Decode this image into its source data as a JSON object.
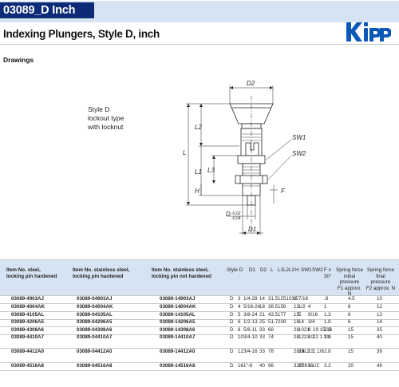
{
  "header": {
    "title": "03089_D Inch",
    "logo_text": "kipp"
  },
  "subtitle": "Indexing Plungers, Style D, inch",
  "section_label": "Drawings",
  "drawing": {
    "note_lines": [
      "Style D",
      "lockout type",
      "with locknut"
    ],
    "labels": {
      "D2": "D2",
      "SW1": "SW1",
      "SW2": "SW2",
      "L": "L",
      "L2": "L2",
      "L1": "L1",
      "L3": "L3",
      "H": "H",
      "F": "F",
      "D1": "D1",
      "D": "D",
      "tol_top": "-0,02",
      "tol_bottom": "-0,04"
    }
  },
  "table": {
    "headers": {
      "item_steel": [
        "Item No. steel,",
        "locking pin hardened"
      ],
      "item_stainless_hard": [
        "Item No. stainless steel,",
        "locking pin hardened"
      ],
      "item_stainless_not": [
        "Item No. stainless steel,",
        "locking pin not hardened"
      ],
      "style": "Style D",
      "d1": "D1",
      "d2": "D2",
      "l": "L",
      "l1": "L1L2L3",
      "h": "H",
      "sw1": "SW1",
      "sw2": "SW2",
      "f": [
        "F x",
        "30°"
      ],
      "spring_initial": [
        "Spring force",
        "initial",
        "pressure",
        "F1 approx. N"
      ],
      "spring_final": [
        "Spring force",
        "final",
        "pressure",
        "F2 approx. N"
      ]
    },
    "rows": [
      {
        "a": "03089-4903AJ",
        "b": "03089-04903AJ",
        "c": "03089-14903AJ",
        "s": "D",
        "d1": "3",
        "d2": "1/4-28",
        "l": "14",
        "l123": "31.5125103.5",
        "h": "8",
        "sw1": "7/16",
        "sw2": "",
        "sw2b": "",
        "f": ".8",
        "f1": "4.5",
        "f2": "10"
      },
      {
        "a": "03089-4004AK",
        "b": "03089-04004AK",
        "c": "03089-14004AK",
        "s": "D",
        "d1": "4",
        "d2": "5/16-24",
        "l": "18",
        "l123": "38.5156",
        "h": "13",
        "sw1": "1/2",
        "sw2": "4",
        "sw2b": "",
        "f": "1",
        "f1": "6",
        "f2": "12"
      },
      {
        "a": "03089-4105AL",
        "b": "03089-04105AL",
        "c": "03089-14105AL",
        "s": "D",
        "d1": "5",
        "d2": "3/8-24",
        "l": "21",
        "l123": "43.5177",
        "h": "15",
        "sw1": "5",
        "sw2": "9/16",
        "sw2b": "",
        "f": "1.3",
        "f1": "6",
        "f2": "12"
      },
      {
        "a": "03089-4206A5",
        "b": "03089-04206A5",
        "c": "03089-14206A5",
        "s": "D",
        "d1": "6",
        "d2": "1/2-13",
        "l": "25",
        "l123": "51.7208",
        "h": "16",
        "sw1": "14",
        "sw2": "3/4",
        "sw2b": "",
        "f": "1.8",
        "f1": "6",
        "f2": "14"
      },
      {
        "a": "03089-4308A6",
        "b": "03089-04308A6",
        "c": "03089-14308A6",
        "s": "D",
        "d1": "8",
        "d2": "5/8-11",
        "l": "33",
        "l123": "68",
        "h": "26",
        "sw1": "1021",
        "sw2": "8",
        "sw2b": "19 15/16",
        "f": "2.3",
        "f1": "15",
        "f2": "35"
      },
      {
        "a": "03089-4410A7",
        "b": "03089-04410A7",
        "c": "03089-14410A7",
        "s": "D",
        "d1": "10",
        "d2": "3/4-10",
        "l": "33",
        "l123": "74",
        "h": "28",
        "sw1": "1223",
        "sw2": "10",
        "sw2b": "22 1 1/8",
        "f": "2.8",
        "f1": "15",
        "f2": "40"
      },
      {
        "a": "03089-4412A0",
        "b": "03089-04412A0",
        "c": "03089-14412A0",
        "s": "D",
        "d1": "12",
        "d2": "3/4-16",
        "l": "33",
        "l123": "78",
        "h": "2814",
        "sw1": "2512",
        "sw2": "22",
        "sw2b": "1 1/8",
        "f": "2.8",
        "f1": "15",
        "f2": "39"
      },
      {
        "a": "03089-4516A8",
        "b": "03089-04516A8",
        "c": "03089-14516A8",
        "s": "D",
        "d1": "16",
        "d2": "1\"-8",
        "l": "40",
        "l123": "96",
        "h": "3282816",
        "sw1": "27",
        "sw2": "1 1/2",
        "sw2b": "",
        "f": "3.2",
        "f1": "20",
        "f2": "46"
      }
    ]
  }
}
